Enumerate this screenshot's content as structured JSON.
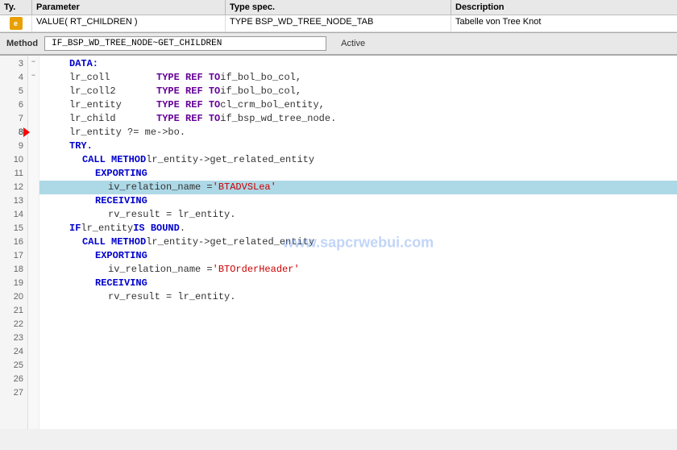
{
  "table": {
    "headers": {
      "ty": "Ty.",
      "parameter": "Parameter",
      "type_spec": "Type spec.",
      "description": "Description"
    },
    "rows": [
      {
        "ty_icon": "export",
        "parameter": "VALUE( RT_CHILDREN )",
        "type_spec": "TYPE BSP_WD_TREE_NODE_TAB",
        "description": "Tabelle von Tree Knot"
      }
    ]
  },
  "method_bar": {
    "label": "Method",
    "name": "IF_BSP_WD_TREE_NODE~GET_CHILDREN",
    "status": "Active"
  },
  "watermark": "www.sapcrwebui.com",
  "code": {
    "lines": [
      {
        "num": "3",
        "indent": 4,
        "fold": "",
        "text": "DATA:",
        "parts": [
          {
            "t": "kw-blue",
            "v": "DATA:"
          }
        ]
      },
      {
        "num": "4",
        "indent": 0,
        "fold": "",
        "text": "",
        "parts": []
      },
      {
        "num": "5",
        "indent": 4,
        "fold": "",
        "text": "lr_coll        TYPE REF TO if_bol_bo_col,",
        "parts": [
          {
            "t": "normal",
            "v": "lr_coll"
          },
          {
            "t": "space",
            "v": "        "
          },
          {
            "t": "kw-type",
            "v": "TYPE REF TO"
          },
          {
            "t": "normal",
            "v": " if_bol_bo_col,"
          }
        ]
      },
      {
        "num": "6",
        "indent": 4,
        "fold": "",
        "text": "lr_coll2       TYPE REF TO if_bol_bo_col,",
        "parts": [
          {
            "t": "normal",
            "v": "lr_coll2"
          },
          {
            "t": "space",
            "v": "       "
          },
          {
            "t": "kw-type",
            "v": "TYPE REF TO"
          },
          {
            "t": "normal",
            "v": " if_bol_bo_col,"
          }
        ]
      },
      {
        "num": "7",
        "indent": 4,
        "fold": "",
        "text": "lr_entity      TYPE REF TO cl_crm_bol_entity,",
        "parts": [
          {
            "t": "normal",
            "v": "lr_entity"
          },
          {
            "t": "space",
            "v": "      "
          },
          {
            "t": "kw-type",
            "v": "TYPE REF TO"
          },
          {
            "t": "normal",
            "v": " cl_crm_bol_entity,"
          }
        ]
      },
      {
        "num": "8",
        "indent": 4,
        "fold": "",
        "text": "lr_child       TYPE REF TO if_bsp_wd_tree_node.",
        "parts": [
          {
            "t": "normal",
            "v": "lr_child"
          },
          {
            "t": "space",
            "v": "       "
          },
          {
            "t": "kw-type",
            "v": "TYPE REF TO"
          },
          {
            "t": "normal",
            "v": " if_bsp_wd_tree_node."
          }
        ],
        "arrow": true
      },
      {
        "num": "9",
        "indent": 0,
        "fold": "",
        "text": "",
        "parts": []
      },
      {
        "num": "10",
        "indent": 4,
        "fold": "",
        "text": "lr_entity ?= me->bo.",
        "parts": [
          {
            "t": "normal",
            "v": "lr_entity ?= me->bo."
          }
        ]
      },
      {
        "num": "11",
        "indent": 0,
        "fold": "",
        "text": "",
        "parts": []
      },
      {
        "num": "12",
        "indent": 4,
        "fold": "minus",
        "text": "TRY.",
        "parts": [
          {
            "t": "kw-blue",
            "v": "TRY."
          }
        ]
      },
      {
        "num": "13",
        "indent": 6,
        "fold": "",
        "text": "CALL METHOD lr_entity->get_related_entity",
        "parts": [
          {
            "t": "kw-blue",
            "v": "CALL METHOD"
          },
          {
            "t": "normal",
            "v": " lr_entity->get_related_entity"
          }
        ]
      },
      {
        "num": "14",
        "indent": 8,
        "fold": "",
        "text": "EXPORTING",
        "parts": [
          {
            "t": "kw-blue",
            "v": "EXPORTING"
          }
        ]
      },
      {
        "num": "15",
        "indent": 10,
        "fold": "",
        "text": "iv_relation_name = 'BTADVSLea'",
        "parts": [
          {
            "t": "normal",
            "v": "iv_relation_name = "
          },
          {
            "t": "str-literal",
            "v": "'BTADVSLea'"
          }
        ],
        "highlight": true
      },
      {
        "num": "16",
        "indent": 8,
        "fold": "",
        "text": "RECEIVING",
        "parts": [
          {
            "t": "kw-blue",
            "v": "RECEIVING"
          }
        ]
      },
      {
        "num": "17",
        "indent": 10,
        "fold": "",
        "text": "rv_result          = lr_entity.",
        "parts": [
          {
            "t": "normal",
            "v": "rv_result          = lr_entity."
          }
        ]
      },
      {
        "num": "18",
        "indent": 0,
        "fold": "",
        "text": "",
        "parts": []
      },
      {
        "num": "19",
        "indent": 0,
        "fold": "",
        "text": "",
        "parts": []
      },
      {
        "num": "20",
        "indent": 4,
        "fold": "minus",
        "text": "IF lr_entity IS BOUND.",
        "parts": [
          {
            "t": "kw-blue",
            "v": "IF"
          },
          {
            "t": "normal",
            "v": " lr_entity "
          },
          {
            "t": "kw-blue",
            "v": "IS BOUND"
          },
          {
            "t": "normal",
            "v": "."
          }
        ]
      },
      {
        "num": "21",
        "indent": 0,
        "fold": "",
        "text": "",
        "parts": []
      },
      {
        "num": "22",
        "indent": 6,
        "fold": "",
        "text": "CALL METHOD lr_entity->get_related_entity",
        "parts": [
          {
            "t": "kw-blue",
            "v": "CALL METHOD"
          },
          {
            "t": "normal",
            "v": " lr_entity->get_related_entity"
          }
        ]
      },
      {
        "num": "23",
        "indent": 8,
        "fold": "",
        "text": "EXPORTING",
        "parts": [
          {
            "t": "kw-blue",
            "v": "EXPORTING"
          }
        ]
      },
      {
        "num": "24",
        "indent": 10,
        "fold": "",
        "text": "iv_relation_name = 'BTOrderHeader'",
        "parts": [
          {
            "t": "normal",
            "v": "iv_relation_name = "
          },
          {
            "t": "str-literal",
            "v": "'BTOrderHeader'"
          }
        ]
      },
      {
        "num": "25",
        "indent": 8,
        "fold": "",
        "text": "RECEIVING",
        "parts": [
          {
            "t": "kw-blue",
            "v": "RECEIVING"
          }
        ]
      },
      {
        "num": "26",
        "indent": 10,
        "fold": "",
        "text": "rv_result          = lr_entity.",
        "parts": [
          {
            "t": "normal",
            "v": "rv_result          = lr_entity."
          }
        ]
      },
      {
        "num": "27",
        "indent": 0,
        "fold": "",
        "text": "",
        "parts": []
      }
    ]
  }
}
